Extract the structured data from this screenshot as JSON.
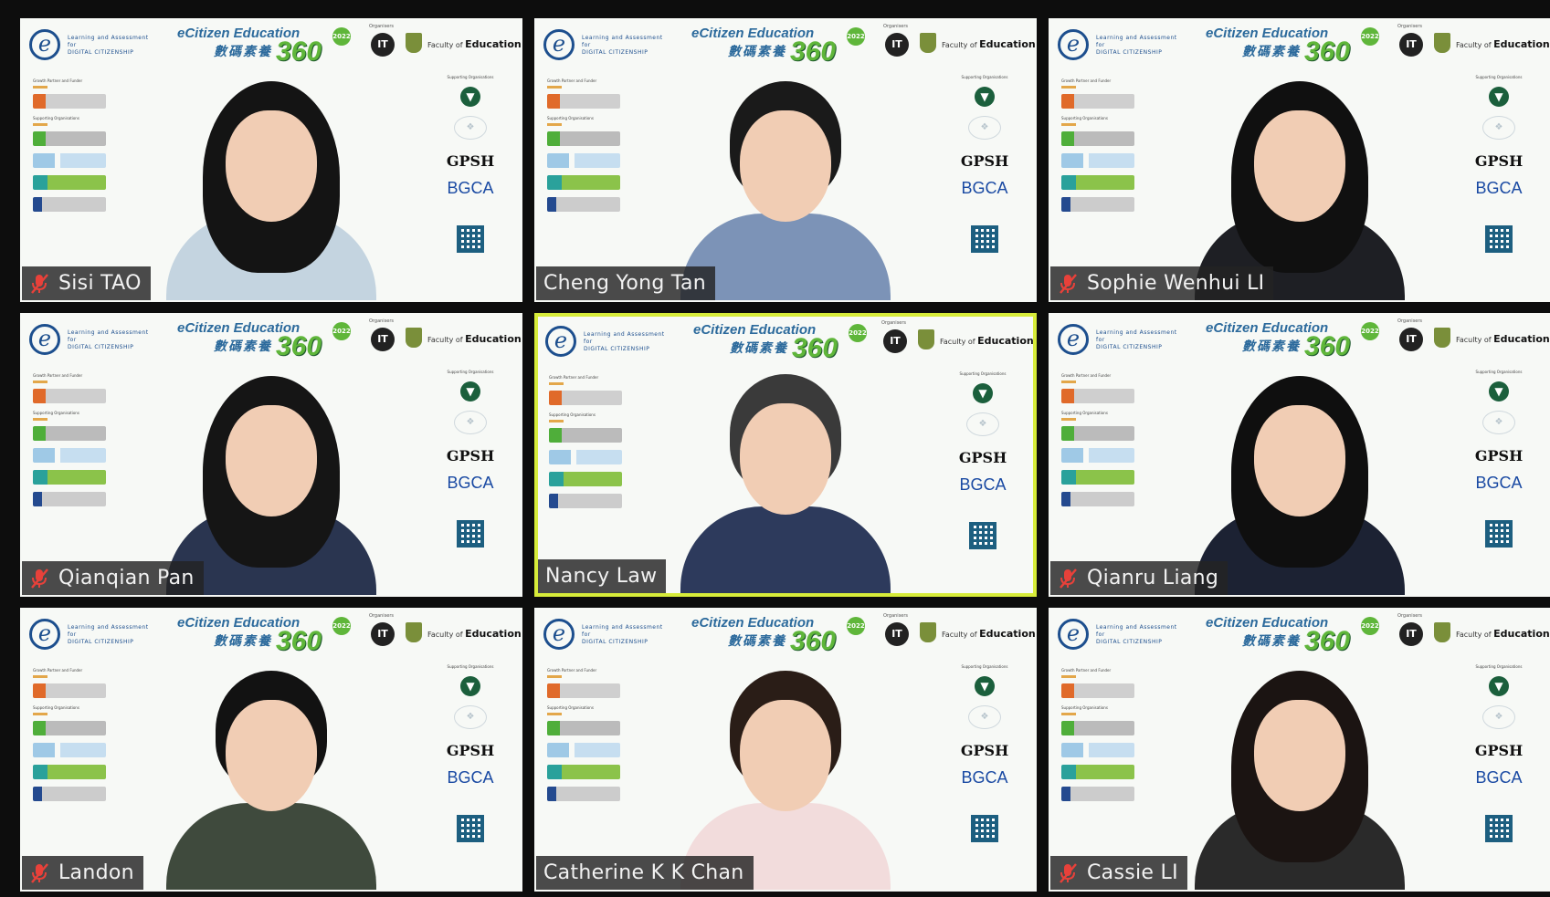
{
  "background": {
    "org_title_line1": "Learning and Assessment for",
    "org_title_line2": "DIGITAL CITIZENSHIP",
    "program_title": "eCitizen Education",
    "program_subtitle": "數碼素養",
    "program_number": "360",
    "program_year": "2022",
    "organizers_label": "Organisers",
    "it_logo": "IT",
    "faculty_prefix": "Faculty of",
    "faculty_name": "Education",
    "growth_partner_label": "Growth Partner and Funder",
    "supporting_label": "Supporting Organisations",
    "gpsh_logo": "GPSH",
    "bgca_logo": "BGCA",
    "colors": {
      "accent_green": "#5fb63a",
      "title_blue": "#2c6a9c",
      "active_border": "#d7ec3a"
    }
  },
  "participants": [
    {
      "name": "Sisi TAO",
      "muted": true,
      "active": false,
      "hair": "#141414",
      "body": "#c4d4e0",
      "long_hair": true
    },
    {
      "name": "Cheng Yong Tan",
      "muted": false,
      "active": false,
      "hair": "#1a1a1a",
      "body": "#7c93b7",
      "long_hair": false
    },
    {
      "name": "Sophie Wenhui LI",
      "muted": true,
      "active": false,
      "hair": "#101010",
      "body": "#1e1f24",
      "long_hair": true
    },
    {
      "name": "Qianqian Pan",
      "muted": true,
      "active": false,
      "hair": "#151515",
      "body": "#2a3550",
      "long_hair": true
    },
    {
      "name": "Nancy Law",
      "muted": false,
      "active": true,
      "hair": "#3a3a3a",
      "body": "#2d3a5c",
      "long_hair": false
    },
    {
      "name": "Qianru Liang",
      "muted": true,
      "active": false,
      "hair": "#0f0f0f",
      "body": "#1c2233",
      "long_hair": true
    },
    {
      "name": "Landon",
      "muted": true,
      "active": false,
      "hair": "#121212",
      "body": "#3f4a3d",
      "long_hair": false
    },
    {
      "name": "Catherine K K Chan",
      "muted": false,
      "active": false,
      "hair": "#2a1d17",
      "body": "#f2dcdc",
      "long_hair": false
    },
    {
      "name": "Cassie LI",
      "muted": true,
      "active": false,
      "hair": "#1b1412",
      "body": "#2a2a2a",
      "long_hair": true
    }
  ]
}
